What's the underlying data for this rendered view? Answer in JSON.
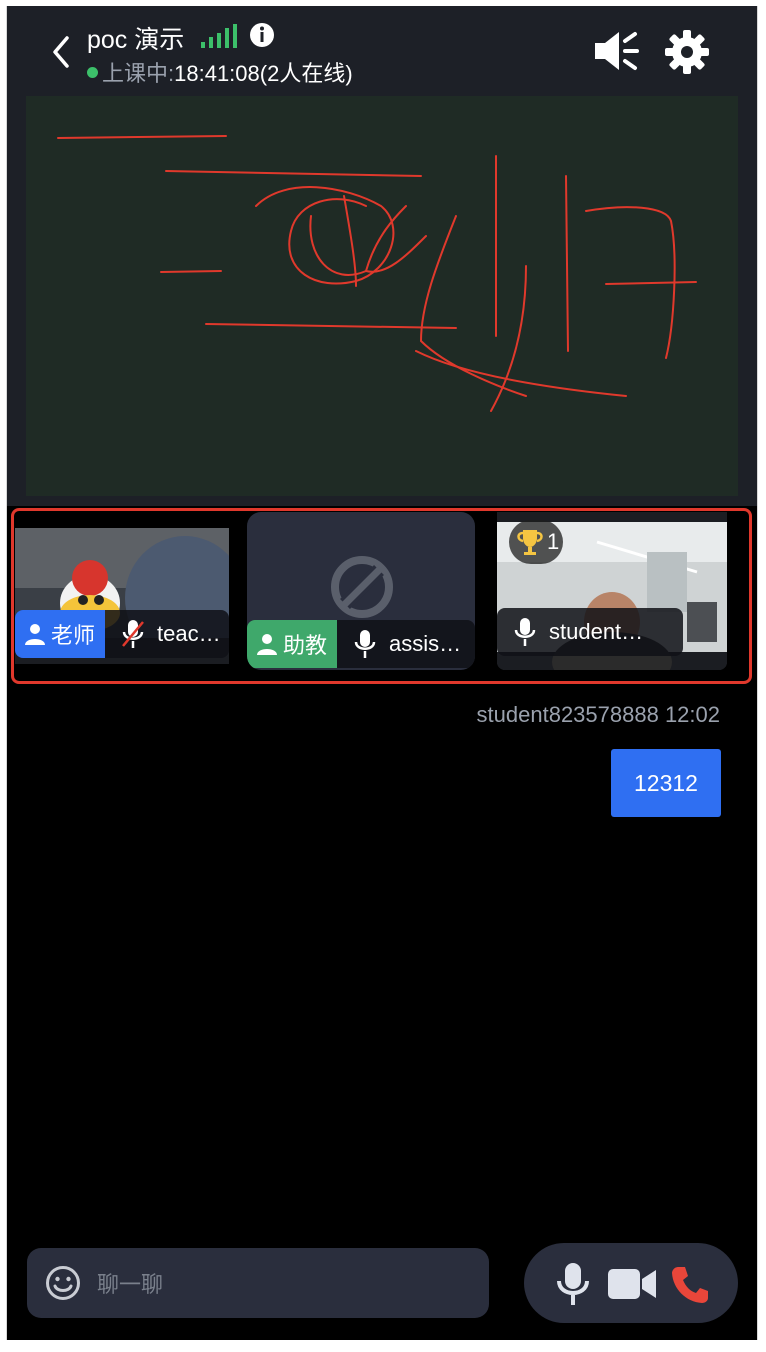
{
  "header": {
    "title": "poc 演示",
    "status_label": "上课中:",
    "status_time": "18:41:08(2人在线)"
  },
  "videos": [
    {
      "role": "老师",
      "name": "teac…",
      "role_color": "#2f6ff2",
      "mic": "muted-icon"
    },
    {
      "role": "助教",
      "name": "assis…",
      "role_color": "#3fa86b",
      "mic": "mic-icon"
    },
    {
      "role": "",
      "name": "student…",
      "trophy_count": "1",
      "mic": "mic-icon"
    }
  ],
  "chat": {
    "sender_meta": "student823578888 12:02",
    "message": "12312",
    "placeholder": "聊一聊"
  },
  "colors": {
    "accent": "#2f6ff2",
    "online": "#3cc06a",
    "highlight_border": "#e0382c",
    "hangup": "#e9463a"
  }
}
